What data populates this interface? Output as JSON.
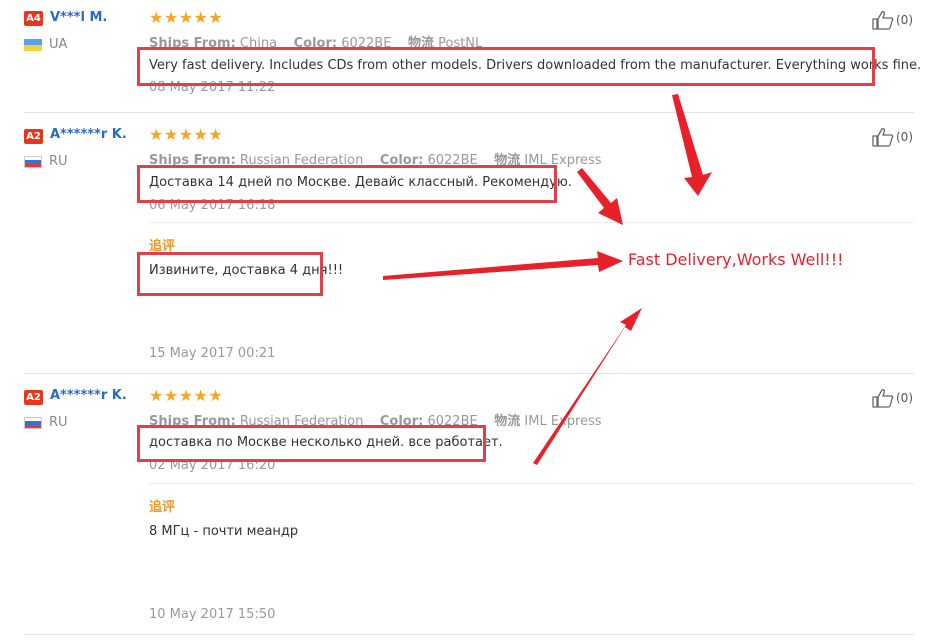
{
  "reviews": [
    {
      "badge": "A4",
      "name": "V***l M.",
      "country": "UA",
      "flag": "ukraine-flag",
      "rating": "★★★★★",
      "ships_from_label": "Ships From:",
      "ships_from": "China",
      "color_label": "Color:",
      "color": "6022BE",
      "logistics_label": "物流",
      "logistics": "PostNL",
      "text": "Very fast delivery. Includes CDs from other models. Drivers downloaded from the manufacturer. Everything works fine.",
      "date": "08 May 2017 11:22",
      "helpful": "(0)"
    },
    {
      "badge": "A2",
      "name": "A******r K.",
      "country": "RU",
      "flag": "russia-flag",
      "rating": "★★★★★",
      "ships_from_label": "Ships From:",
      "ships_from": "Russian Federation",
      "color_label": "Color:",
      "color": "6022BE",
      "logistics_label": "物流",
      "logistics": "IML Express",
      "text": "Доставка 14 дней по Москве. Девайс классный. Рекомендую.",
      "date": "06 May 2017 16:18",
      "helpful": "(0)",
      "followup": {
        "label": "追评",
        "text": "Извините, доставка 4 дня!!!",
        "date": "15 May 2017 00:21"
      }
    },
    {
      "badge": "A2",
      "name": "A******r K.",
      "country": "RU",
      "flag": "russia-flag",
      "rating": "★★★★★",
      "ships_from_label": "Ships From:",
      "ships_from": "Russian Federation",
      "color_label": "Color:",
      "color": "6022BE",
      "logistics_label": "物流",
      "logistics": "IML Express",
      "text": "доставка по Москве несколько дней. все работает.",
      "date": "02 May 2017 16:20",
      "helpful": "(0)",
      "followup": {
        "label": "追评",
        "text": "8 МГц - почти меандр",
        "date": "10 May 2017 15:50"
      }
    }
  ],
  "annotation": {
    "text": "Fast Delivery,Works Well!!!"
  },
  "colors": {
    "accent_red": "#e04048",
    "name_blue": "#2a6ac7",
    "star_orange": "#f5a623",
    "followup_orange": "#e89b2c"
  }
}
